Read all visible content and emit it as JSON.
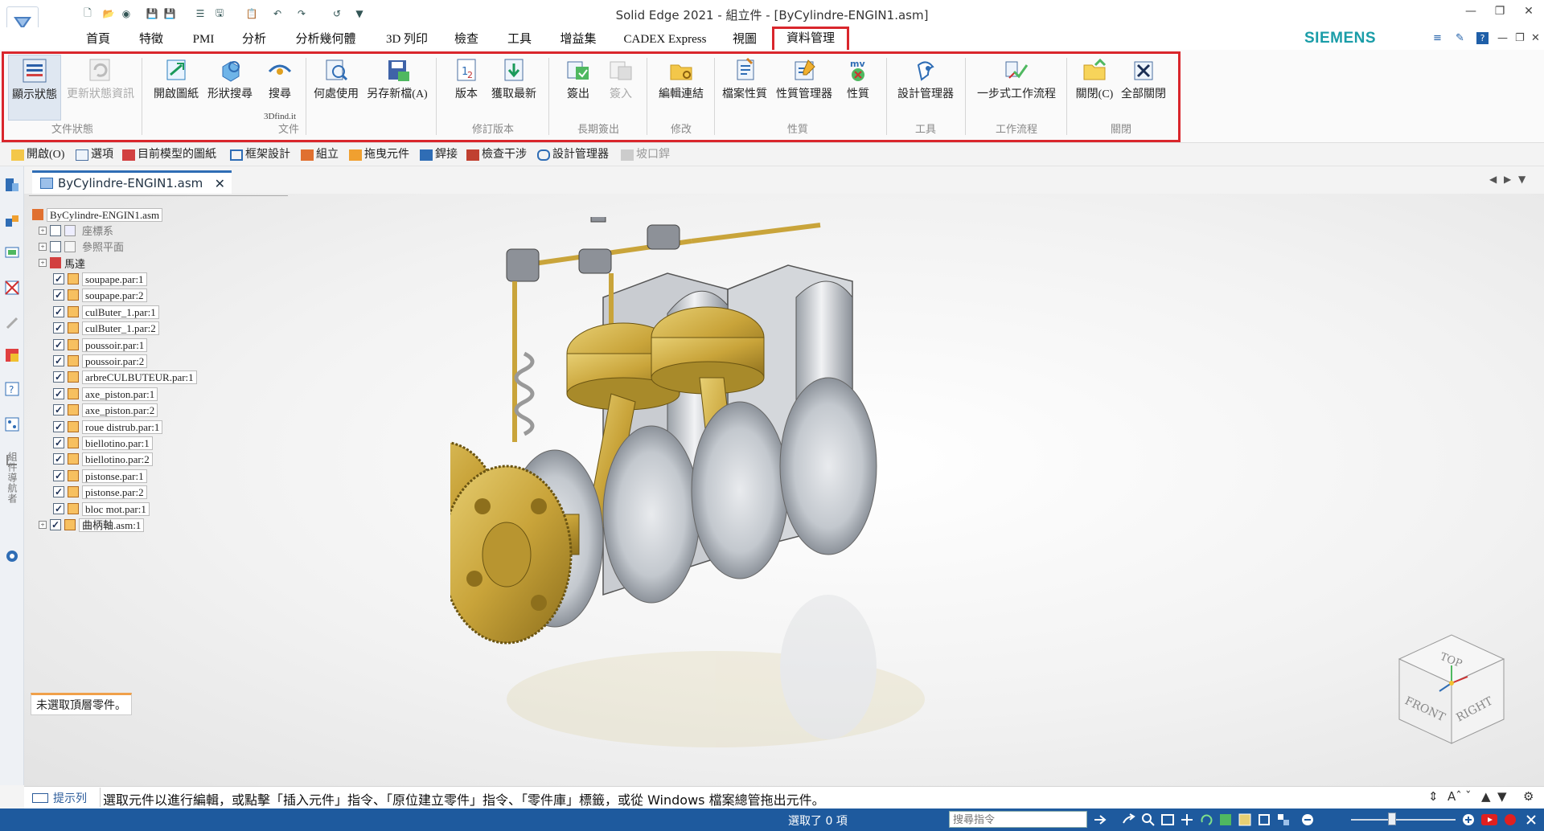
{
  "window": {
    "title": "Solid Edge 2021 - 組立件 - [ByCylindre-ENGIN1.asm]",
    "brand": "SIEMENS",
    "controls": [
      "minimize",
      "restore",
      "close"
    ]
  },
  "menu": {
    "tabs": [
      "首頁",
      "特徵",
      "PMI",
      "分析",
      "分析幾何體",
      "3D 列印",
      "檢查",
      "工具",
      "增益集",
      "CADEX Express",
      "視圖",
      "資料管理"
    ],
    "active_tab": "資料管理"
  },
  "ribbon": {
    "buttons": {
      "display_status": "顯示狀態",
      "update_status": "更新狀態資訊",
      "open_drawing": "開啟圖紙",
      "shape_search": "形狀搜尋",
      "search_3dfind": "搜尋",
      "search_3dfind_sub": "3Dfind.it",
      "where_used": "何處使用",
      "save_as_new": "另存新檔(A)",
      "revision": "版本",
      "get_latest": "獲取最新",
      "check_out": "簽出",
      "check_in": "簽入",
      "edit_links": "編輯連結",
      "file_properties": "檔案性質",
      "property_manager": "性質管理器",
      "properties": "性質",
      "design_manager": "設計管理器",
      "one_step_workflow": "一步式工作流程",
      "close": "關閉(C)",
      "close_all": "全部關閉"
    },
    "groups": {
      "file_status": "文件狀態",
      "document": "文件",
      "revision": "修訂版本",
      "long_term_checkout": "長期簽出",
      "modify": "修改",
      "properties": "性質",
      "tools": "工具",
      "workflow": "工作流程",
      "close": "關閉"
    }
  },
  "command_bar": {
    "items": [
      "開啟(O)",
      "選項",
      "目前模型的圖紙",
      "框架設計",
      "組立",
      "拖曳元件",
      "銲接",
      "檢查干涉",
      "設計管理器",
      "坡口銲"
    ]
  },
  "left_toolbar": {
    "vertical_label": "組件導航者"
  },
  "document_tab": {
    "name": "ByCylindre-ENGIN1.asm"
  },
  "tree": {
    "root": "ByCylindre-ENGIN1.asm",
    "nodes": [
      {
        "label": "座標系",
        "checked": false,
        "expandable": true,
        "level": 1,
        "dim": true
      },
      {
        "label": "參照平面",
        "checked": false,
        "expandable": true,
        "level": 1,
        "dim": true
      },
      {
        "label": "馬達",
        "checked": null,
        "expandable": true,
        "level": 1,
        "dim": false
      }
    ],
    "parts": [
      {
        "label": "soupape.par:1",
        "checked": true
      },
      {
        "label": "soupape.par:2",
        "checked": true
      },
      {
        "label": "culButer_1.par:1",
        "checked": true
      },
      {
        "label": "culButer_1.par:2",
        "checked": true
      },
      {
        "label": "poussoir.par:1",
        "checked": true
      },
      {
        "label": "poussoir.par:2",
        "checked": true
      },
      {
        "label": "arbreCULBUTEUR.par:1",
        "checked": true
      },
      {
        "label": "axe_piston.par:1",
        "checked": true
      },
      {
        "label": "axe_piston.par:2",
        "checked": true
      },
      {
        "label": "roue distrub.par:1",
        "checked": true
      },
      {
        "label": "biellotino.par:1",
        "checked": true
      },
      {
        "label": "biellotino.par:2",
        "checked": true
      },
      {
        "label": "pistonse.par:1",
        "checked": true
      },
      {
        "label": "pistonse.par:2",
        "checked": true
      },
      {
        "label": "bloc mot.par:1",
        "checked": true
      },
      {
        "label": "曲柄軸.asm:1",
        "checked": true
      }
    ],
    "status": "未選取頂層零件。"
  },
  "view_cube": {
    "top": "TOP",
    "front": "FRONT",
    "right": "RIGHT"
  },
  "prompt": {
    "label": "提示列",
    "text": "選取元件以進行編輯，或點擊「插入元件」指令、「原位建立零件」指令、「零件庫」標籤，或從 Windows 檔案總管拖出元件。"
  },
  "status_bar": {
    "text": "選取了 0 項",
    "search_placeholder": "搜尋指令"
  },
  "colors": {
    "highlight": "#d9262c",
    "status_bar": "#1e5a9e",
    "brand": "#1a9da8",
    "gold": "#c9a43a",
    "steel": "#c7cbd0"
  }
}
